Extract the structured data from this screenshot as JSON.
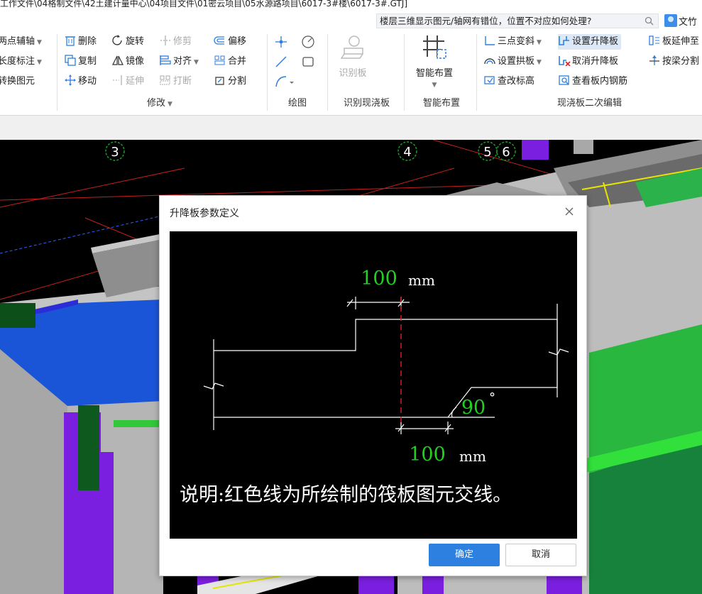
{
  "window": {
    "title": "工作文件\\04格制文件\\42土建计量中心\\04项目文件\\01密云项目\\05水源路项目\\6017-3#楼\\6017-3#.GTJ]"
  },
  "search": {
    "value": "楼层三维显示图元/轴网有错位，位置不对应如何处理?",
    "icon": "search-icon"
  },
  "user": {
    "name": "文竹"
  },
  "ribbon": {
    "left_partial": {
      "items": [
        "两点辅轴",
        "长度标注",
        "转换图元"
      ]
    },
    "modify": {
      "label": "修改",
      "items": [
        "删除",
        "旋转",
        "修剪",
        "偏移",
        "复制",
        "镜像",
        "对齐",
        "合并",
        "移动",
        "延伸",
        "打断",
        "分割"
      ]
    },
    "draw": {
      "label": "绘图"
    },
    "identify": {
      "label": "识别现浇板",
      "button": "识别板"
    },
    "smart": {
      "label": "智能布置",
      "button": "智能布置"
    },
    "edit2": {
      "label": "现浇板二次编辑",
      "items": [
        "三点变斜",
        "设置升降板",
        "板延伸至",
        "设置拱板",
        "取消升降板",
        "按梁分割",
        "查改标高",
        "查看板内钢筋"
      ]
    }
  },
  "viewport": {
    "axis_labels": [
      "3",
      "4",
      "5",
      "6"
    ]
  },
  "dialog": {
    "title": "升降板参数定义",
    "diagram": {
      "top_offset_value": "100",
      "top_offset_unit": "mm",
      "bottom_offset_value": "100",
      "bottom_offset_unit": "mm",
      "angle_value": "90",
      "angle_unit": "°",
      "note": "说明:红色线为所绘制的筏板图元交线。"
    },
    "ok_label": "确定",
    "cancel_label": "取消"
  },
  "colors": {
    "accent": "#2d7fe0",
    "diagram_green": "#22d022",
    "diagram_red": "#e02020",
    "slab_blue": "#1a5cd6",
    "beam_purple": "#7a1fe0",
    "wall_gray": "#b8b8b8"
  }
}
